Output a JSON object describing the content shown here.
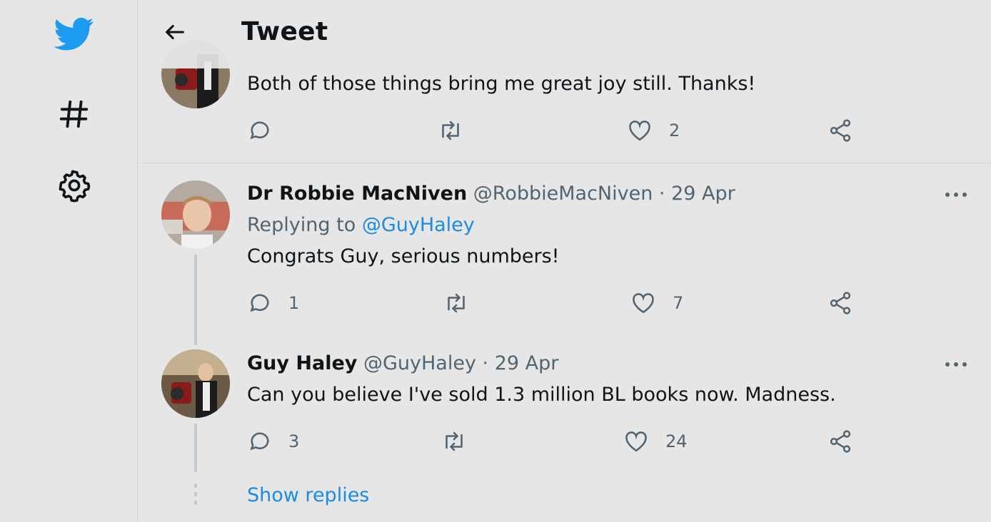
{
  "header": {
    "title": "Tweet",
    "back_icon": "arrow-left-icon"
  },
  "sidebar": {
    "items": [
      {
        "icon": "twitter-bird-icon",
        "color": "#1d9bf0"
      },
      {
        "icon": "hashtag-icon"
      },
      {
        "icon": "gear-icon"
      }
    ]
  },
  "tweets": [
    {
      "text": "Both of those things bring me great joy still. Thanks!",
      "replies": "",
      "retweets": "",
      "likes": "2"
    },
    {
      "name": "Dr Robbie MacNiven",
      "handle": "@RobbieMacNiven",
      "separator": "·",
      "date": "29 Apr",
      "replying_prefix": "Replying to ",
      "replying_to": "@GuyHaley",
      "text": "Congrats Guy, serious numbers!",
      "replies": "1",
      "retweets": "",
      "likes": "7"
    },
    {
      "name": "Guy Haley",
      "handle": "@GuyHaley",
      "separator": "·",
      "date": "29 Apr",
      "text": "Can you believe I've sold 1.3 million BL books now. Madness.",
      "replies": "3",
      "retweets": "",
      "likes": "24"
    }
  ],
  "show_replies": "Show replies",
  "colors": {
    "accent": "#1d8be0",
    "brand": "#1d9bf0",
    "muted": "#536471",
    "background": "#e6e6e6"
  }
}
